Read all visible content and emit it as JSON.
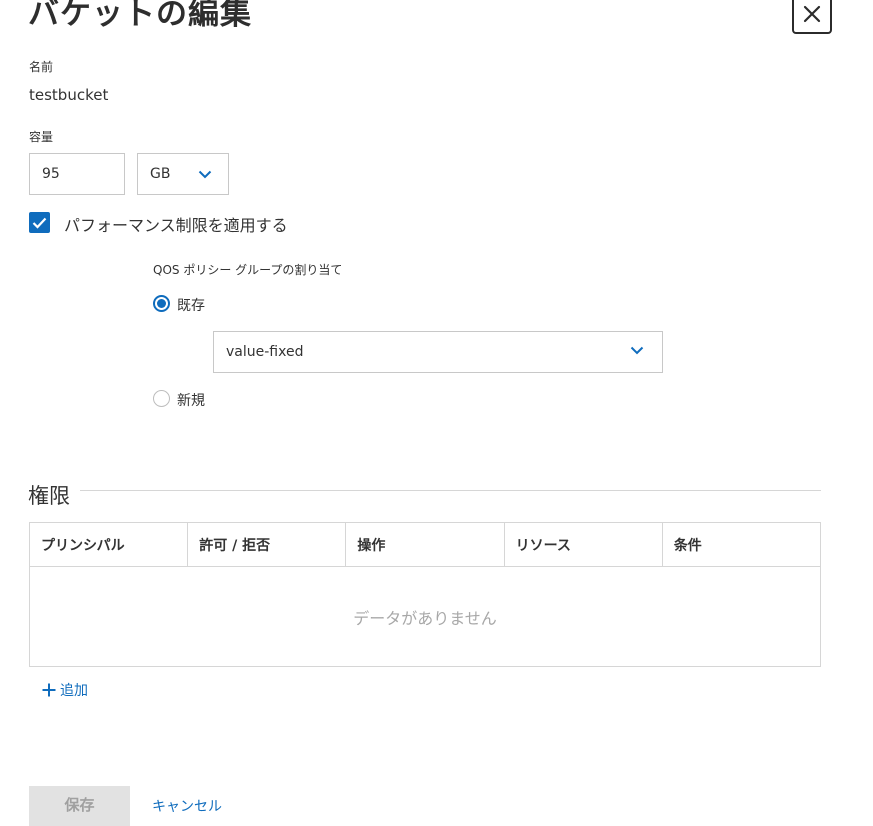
{
  "dialog": {
    "title": "バケットの編集"
  },
  "fields": {
    "name_label": "名前",
    "name_value": "testbucket",
    "capacity_label": "容量",
    "capacity_value": "95",
    "capacity_unit": "GB"
  },
  "performance": {
    "checkbox_label": "パフォーマンス制限を適用する",
    "checked": true,
    "qos_label": "QOS ポリシー グループの割り当て",
    "option_existing": "既存",
    "option_new": "新規",
    "selected_option": "既存",
    "policy_value": "value-fixed"
  },
  "permissions": {
    "title": "権限",
    "columns": [
      "プリンシパル",
      "許可 / 拒否",
      "操作",
      "リソース",
      "条件"
    ],
    "empty_text": "データがありません",
    "add_label": "追加"
  },
  "footer": {
    "save_label": "保存",
    "cancel_label": "キャンセル"
  },
  "colors": {
    "accent": "#0f6cbd",
    "border": "#c8c8c8"
  }
}
